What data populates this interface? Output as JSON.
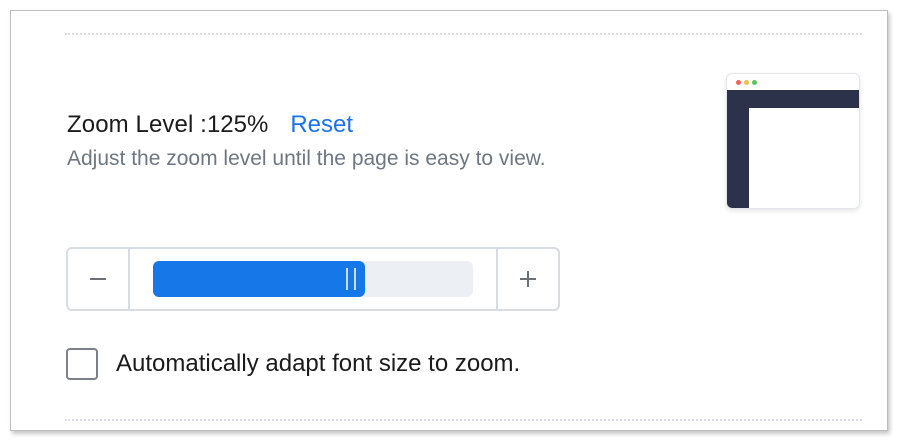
{
  "zoom": {
    "label": "Zoom Level : ",
    "value": "125%",
    "reset_label": "Reset",
    "description": "Adjust the zoom level until the page is easy to view.",
    "slider_fill_fraction": 0.661
  },
  "preview": {
    "dot_colors": [
      "#f0625b",
      "#f5bd4f",
      "#59c55b"
    ],
    "nav_color": "#2b324a"
  },
  "font_option": {
    "label": "Automatically adapt font size to zoom.",
    "checked": false
  },
  "colors": {
    "accent": "#1677e8",
    "link": "#1a73e8"
  }
}
